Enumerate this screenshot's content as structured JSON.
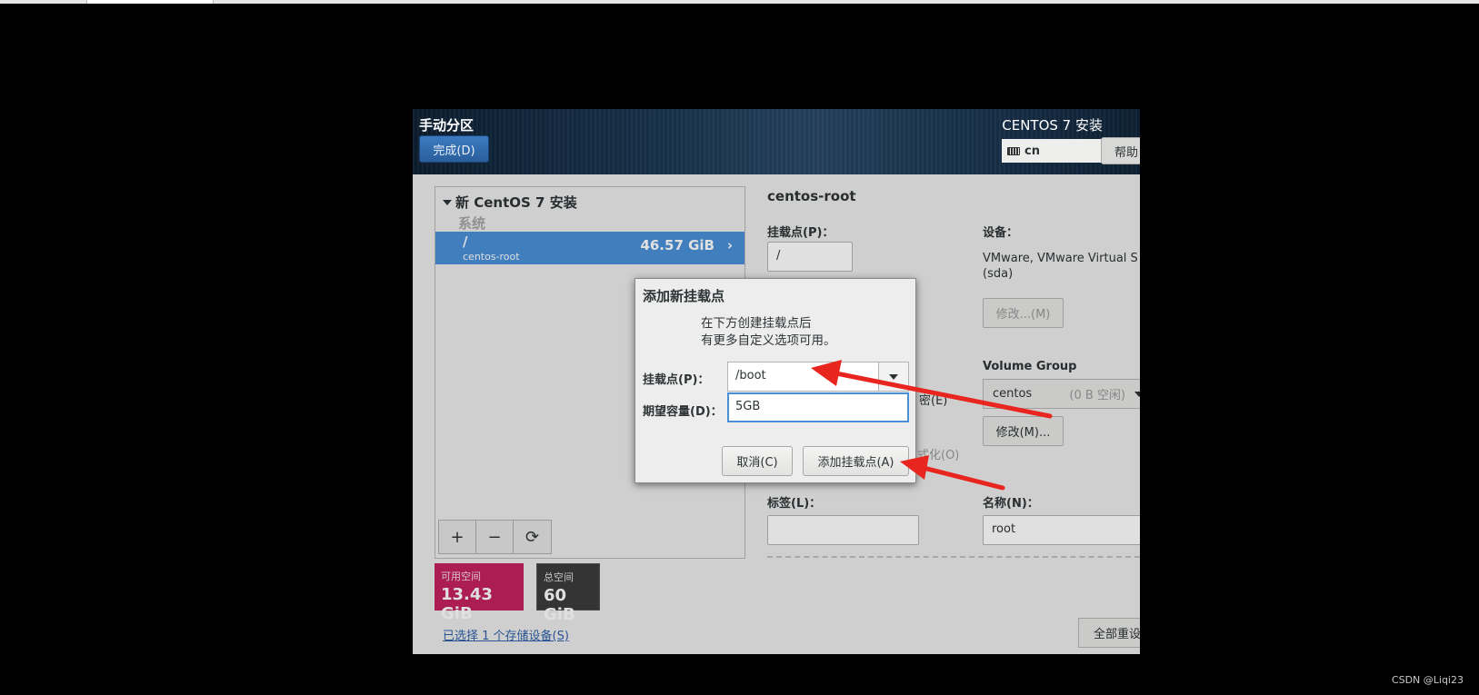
{
  "header": {
    "title": "手动分区",
    "done_button": "完成(D)",
    "product": "CENTOS 7 安装",
    "keyboard_layout": "cn",
    "help_button": "帮助"
  },
  "left_panel": {
    "install_group": "新 CentOS 7 安装",
    "system_label": "系统",
    "mount_row": {
      "mount_point": "/",
      "device": "centos-root",
      "size": "46.57 GiB"
    },
    "toolbar": {
      "add": "+",
      "remove": "−",
      "refresh": "⟳"
    }
  },
  "space": {
    "available_label": "可用空间",
    "available_value": "13.43 GiB",
    "total_label": "总空间",
    "total_value": "60 GiB"
  },
  "storage_link": "已选择 1 个存储设备(S)",
  "details": {
    "title": "centos-root",
    "mount_point_label": "挂载点(P)：",
    "mount_point_value": "/",
    "device_label": "设备：",
    "device_value_line1": "VMware, VMware Virtual S",
    "device_value_line2": "(sda)",
    "modify_button": "修改...(M)",
    "volume_group_label": "Volume Group",
    "volume_group_value": "centos",
    "volume_group_free": "(0 B 空闲)",
    "modify_vg_button": "修改(M)...",
    "encrypt_partial": "密(E)",
    "format_partial": "式化(O)",
    "label_label": "标签(L)：",
    "label_value": "",
    "name_label": "名称(N)：",
    "name_value": "root",
    "reset_button": "全部重设"
  },
  "dialog": {
    "title": "添加新挂载点",
    "description_line1": "在下方创建挂载点后",
    "description_line2": "有更多自定义选项可用。",
    "mount_point_label": "挂载点(P)：",
    "mount_point_value": "/boot",
    "capacity_label": "期望容量(D)：",
    "capacity_value": "5GB",
    "cancel_button": "取消(C)",
    "add_button": "添加挂载点(A)"
  },
  "annotation_color": "#e8251f",
  "watermark": "CSDN @Liqi23"
}
